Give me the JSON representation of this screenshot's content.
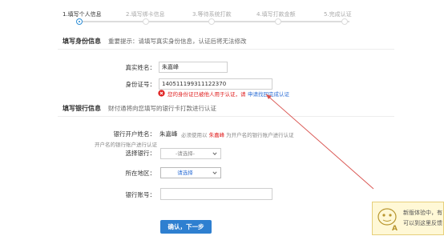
{
  "steps": [
    {
      "label": "1.填写个人信息",
      "state": "active"
    },
    {
      "label": "2.填写绑卡信息",
      "state": "inactive"
    },
    {
      "label": "3.等待系统打款",
      "state": "inactive"
    },
    {
      "label": "4.填写打款金额",
      "state": "inactive"
    },
    {
      "label": "5.完成认证",
      "state": "inactive"
    }
  ],
  "identity": {
    "title": "填写身份信息",
    "hint": "重要提示：请填写真实身份信息，认证后将无法修改",
    "name_label": "真实姓名：",
    "name_value": "朱嘉峰",
    "id_label": "身份证号：",
    "id_value": "140511199311122370",
    "error_text": "您的身份证已被他人用于认证，请",
    "error_link": "申请找回完成认证"
  },
  "bank": {
    "title": "填写银行信息",
    "hint": "财付通将向您填写的银行卡打款进行认证",
    "holder_label": "银行开户姓名：",
    "holder_value": "朱嘉峰",
    "holder_note_prefix": "必须使用以",
    "holder_note_name": "朱嘉峰",
    "holder_note_suffix": "为开户名的银行账户进行认证",
    "holder_note2": "开户名的银行账户进行认证",
    "bank_label": "选择银行：",
    "bank_select": "-请选择-",
    "region_label": "所在地区：",
    "region_select": "请选择",
    "account_label": "银行账号：",
    "account_value": ""
  },
  "submit_label": "确认，下一步",
  "feedback": {
    "line1": "新版体验中，有",
    "line2": "可以到这里反馈"
  },
  "colors": {
    "accent": "#2e8fd6",
    "button": "#2e7fd0",
    "error": "#e02020",
    "annotation_arrow": "#d9534f"
  }
}
